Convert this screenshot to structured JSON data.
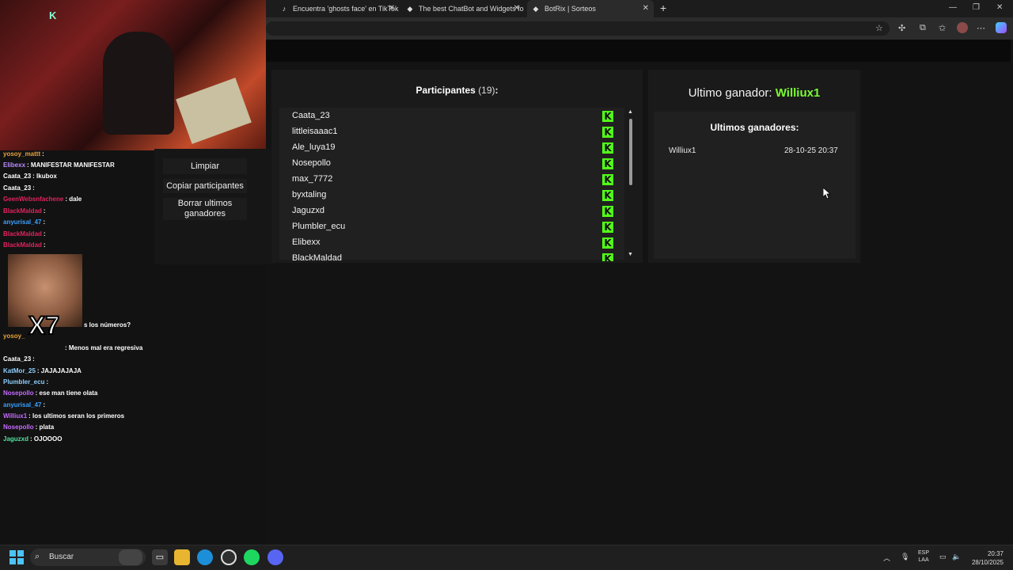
{
  "browser": {
    "tabs": [
      {
        "label": "Encuentra 'ghosts face' en TikTok",
        "icon": "tiktok-icon"
      },
      {
        "label": "The best ChatBot and Widgets fo",
        "icon": "botrix-icon"
      },
      {
        "label": "BotRix | Sorteos",
        "icon": "botrix-icon"
      }
    ]
  },
  "webcam": {
    "logo": "K"
  },
  "chat": {
    "lines": [
      {
        "user": "yosoy_mattt",
        "text": ":",
        "color": "#e8a23a"
      },
      {
        "user": "Elibexx",
        "text": ": MANIFESTAR MANIFESTAR",
        "color": "#b98cff"
      },
      {
        "user": "Caata_23",
        "text": ": lkubox",
        "color": "#ffffff"
      },
      {
        "user": "Caata_23",
        "text": ":",
        "color": "#ffffff"
      },
      {
        "user": "GeenWebsnfachene",
        "text": ": dale",
        "color": "#e0245e"
      },
      {
        "user": "BlackMaldad",
        "text": ":",
        "color": "#e0245e"
      },
      {
        "user": "anyurisal_47",
        "text": ":",
        "color": "#3aa0ff"
      },
      {
        "user": "BlackMaldad",
        "text": ":",
        "color": "#e0245e"
      },
      {
        "user": "BlackMaldad",
        "text": ":",
        "color": "#e0245e"
      },
      {
        "user": "",
        "text": "s los números?",
        "color": "#ffffff"
      },
      {
        "user": "yosoy_",
        "text": "",
        "color": "#e8a23a"
      },
      {
        "user": "",
        "text": ": Menos mal era regresiva",
        "color": "#ffffff"
      },
      {
        "user": "Caata_23",
        "text": ":",
        "color": "#ffffff"
      },
      {
        "user": "KatMor_25",
        "text": ": JAJAJAJAJA",
        "color": "#8fd0ff"
      },
      {
        "user": "Plumbler_ecu",
        "text": ":",
        "color": "#8fd0ff"
      },
      {
        "user": "Nosepollo",
        "text": ": ese man tiene olata",
        "color": "#c56bff"
      },
      {
        "user": "anyurisal_47",
        "text": ":",
        "color": "#3aa0ff"
      },
      {
        "user": "Williux1",
        "text": ": los ultimos seran los primeros",
        "color": "#c56bff"
      },
      {
        "user": "Nosepollo",
        "text": ": plata",
        "color": "#c56bff"
      },
      {
        "user": "Jaguzxd",
        "text": ": OJOOOO",
        "color": "#53e0a0"
      }
    ],
    "meme_text": "X7"
  },
  "menu": {
    "clear": "Limpiar",
    "copy": "Copiar participantes",
    "delete_l1": "Borrar ultimos",
    "delete_l2": "ganadores"
  },
  "participants": {
    "title": "Participantes",
    "count": "(19)",
    "colon": ":",
    "kick_glyph": "K",
    "list": [
      "Caata_23",
      "littleisaaac1",
      "Ale_luya19",
      "Nosepollo",
      "max_7772",
      "byxtaling",
      "Jaguzxd",
      "Plumbler_ecu",
      "Elibexx",
      "BlackMaldad"
    ]
  },
  "winners": {
    "last_label": "Ultimo ganador:",
    "last_name": "Williux1",
    "list_title": "Ultimos ganadores:",
    "entries": [
      {
        "name": "Williux1",
        "date": "28-10-25 20:37"
      }
    ]
  },
  "taskbar": {
    "search": "Buscar",
    "lang_top": "ESP",
    "lang_bottom": "LAA",
    "time": "20:37",
    "date": "28/10/2025"
  },
  "colors": {
    "accent": "#7bfc32",
    "kick": "#53fc18"
  }
}
